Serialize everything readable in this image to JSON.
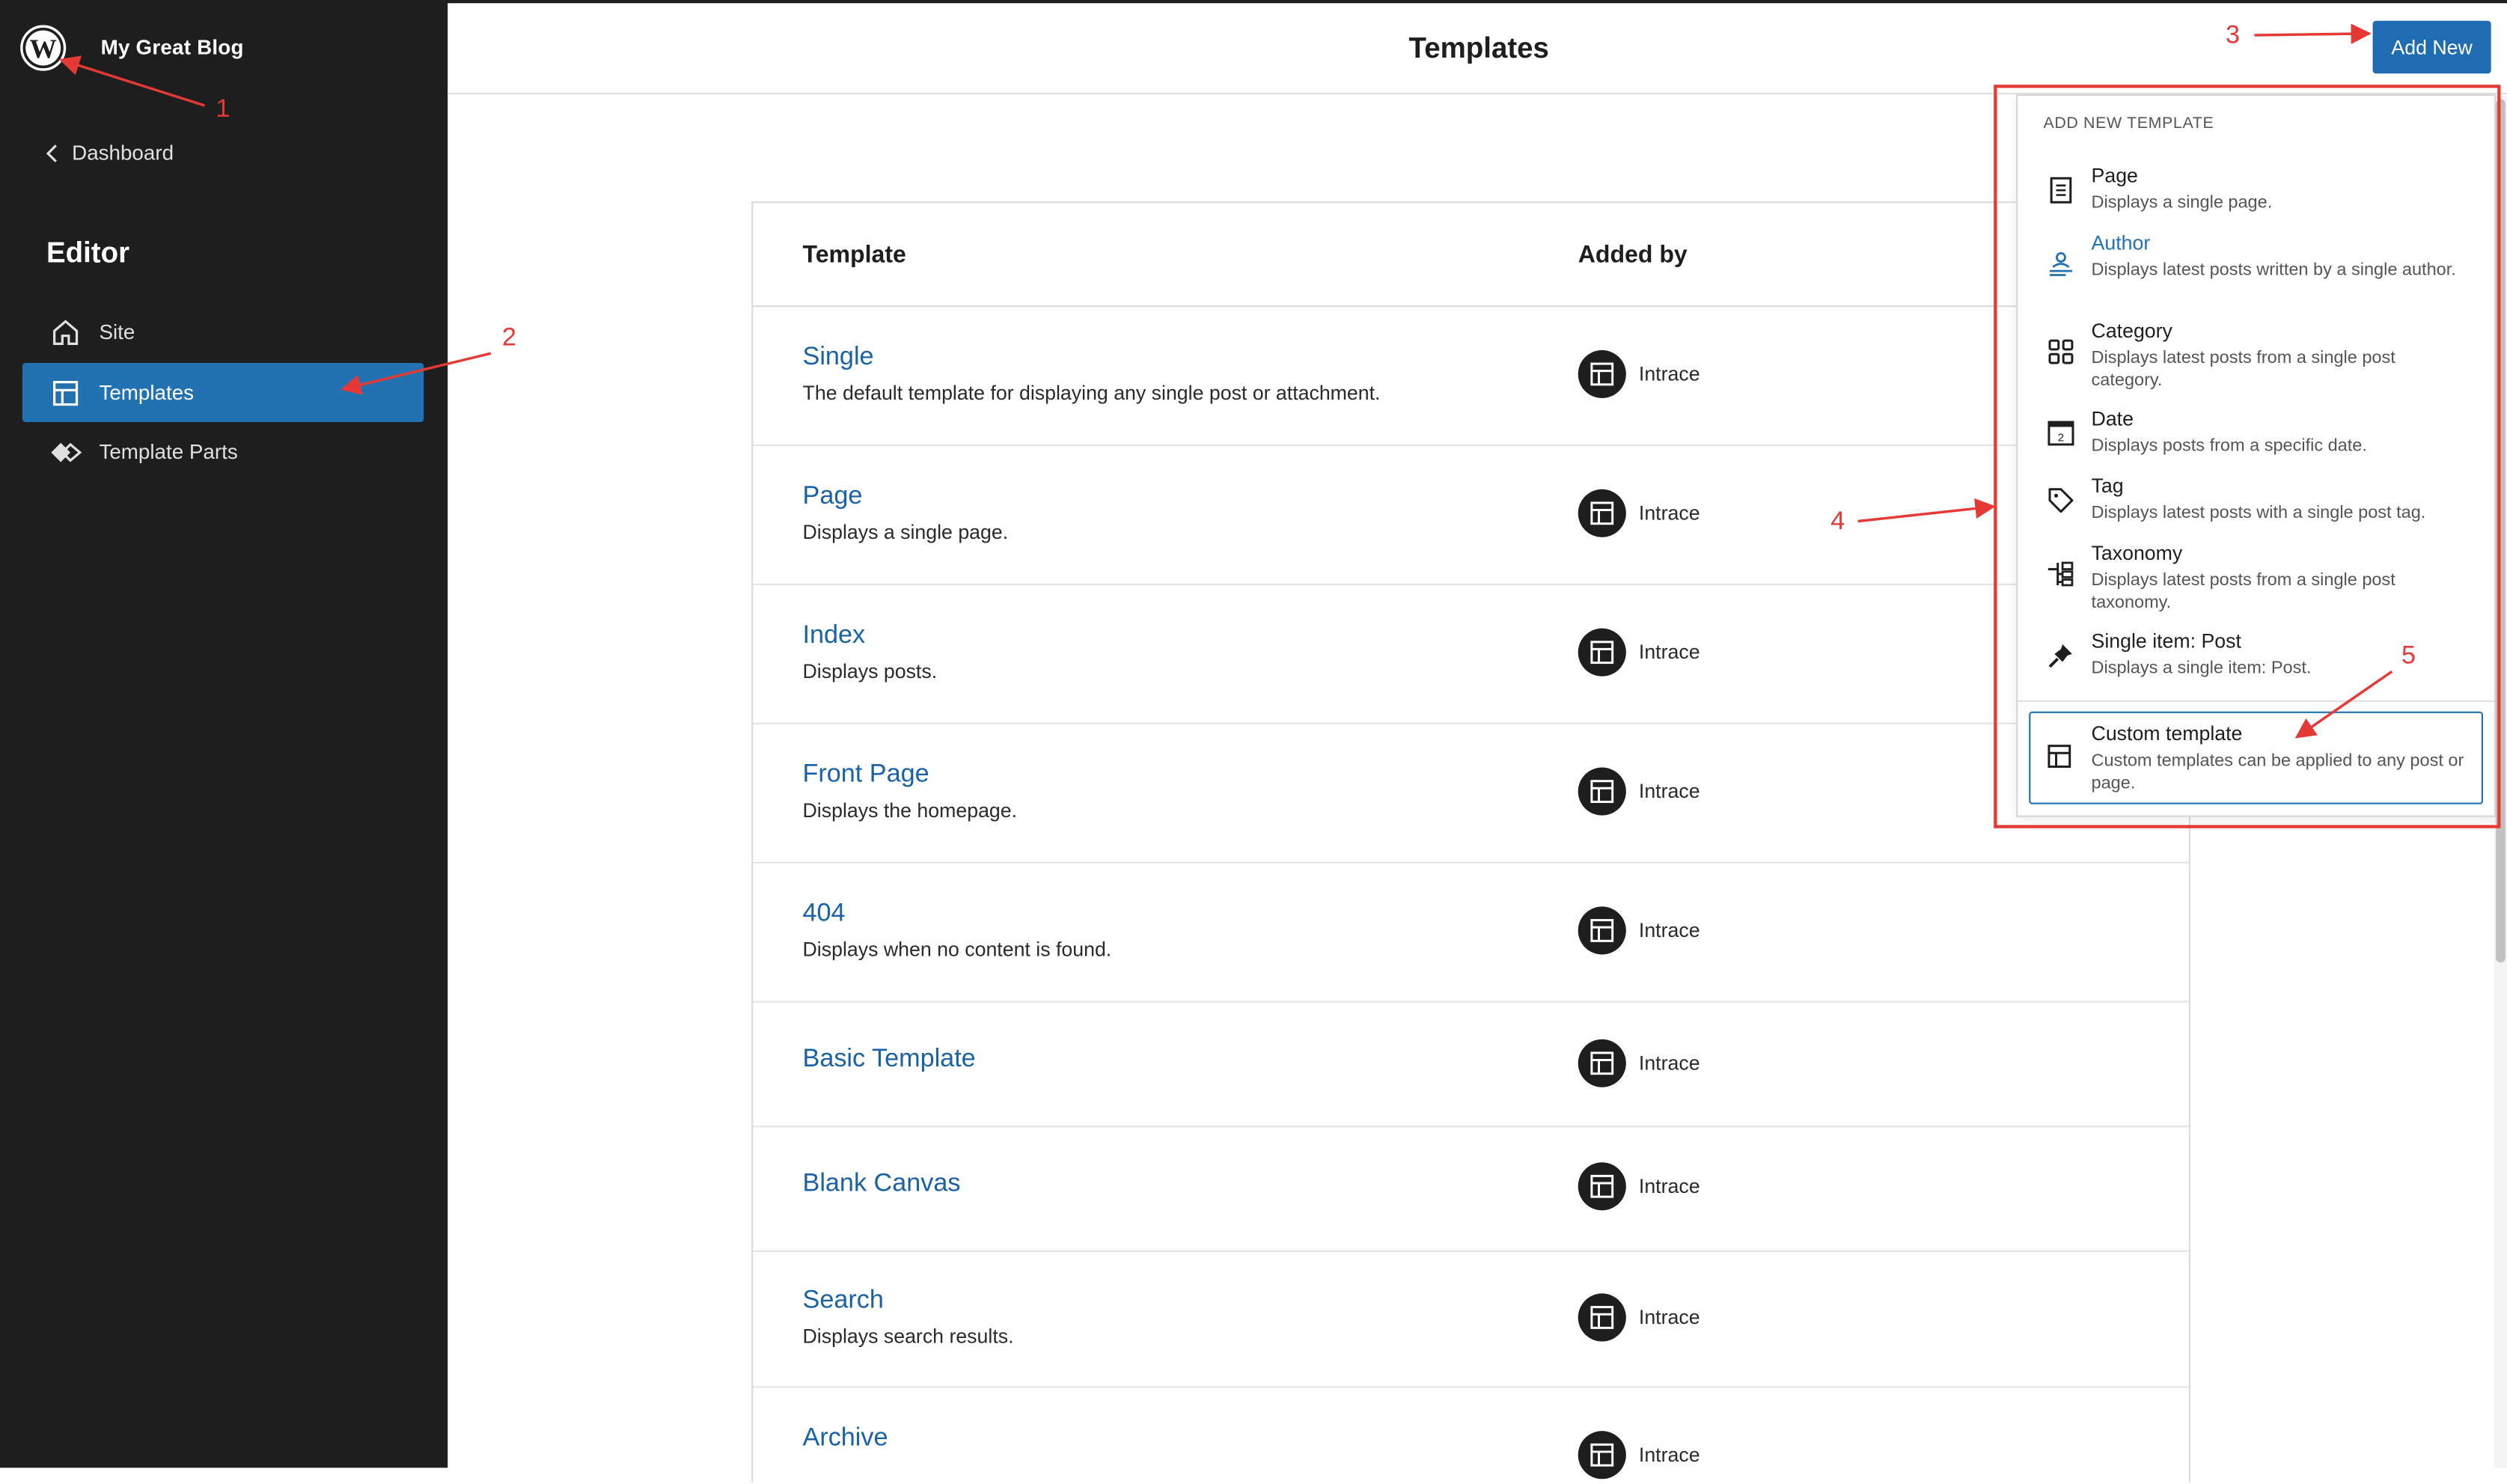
{
  "sidebar": {
    "site_title": "My Great Blog",
    "dashboard_link": "Dashboard",
    "section_heading": "Editor",
    "items": [
      {
        "label": "Site",
        "icon": "home-icon",
        "active": false
      },
      {
        "label": "Templates",
        "icon": "layout-icon",
        "active": true
      },
      {
        "label": "Template Parts",
        "icon": "diamond-icon",
        "active": false
      }
    ]
  },
  "header": {
    "title": "Templates",
    "add_new_label": "Add New"
  },
  "table": {
    "columns": [
      "Template",
      "Added by"
    ],
    "rows": [
      {
        "name": "Single",
        "description": "The default template for displaying any single post or attachment.",
        "added_by": "Intrace"
      },
      {
        "name": "Page",
        "description": "Displays a single page.",
        "added_by": "Intrace"
      },
      {
        "name": "Index",
        "description": "Displays posts.",
        "added_by": "Intrace"
      },
      {
        "name": "Front Page",
        "description": "Displays the homepage.",
        "added_by": "Intrace"
      },
      {
        "name": "404",
        "description": "Displays when no content is found.",
        "added_by": "Intrace"
      },
      {
        "name": "Basic Template",
        "description": "",
        "added_by": "Intrace"
      },
      {
        "name": "Blank Canvas",
        "description": "",
        "added_by": "Intrace"
      },
      {
        "name": "Search",
        "description": "Displays search results.",
        "added_by": "Intrace"
      },
      {
        "name": "Archive",
        "description": "",
        "added_by": "Intrace"
      }
    ]
  },
  "dropdown": {
    "heading": "ADD NEW TEMPLATE",
    "items": [
      {
        "title": "Page",
        "description": "Displays a single page.",
        "icon": "page-icon"
      },
      {
        "title": "Author",
        "description": "Displays latest posts written by a single author.",
        "icon": "author-icon"
      },
      {
        "title": "Category",
        "description": "Displays latest posts from a single post category.",
        "icon": "category-icon"
      },
      {
        "title": "Date",
        "description": "Displays posts from a specific date.",
        "icon": "calendar-icon"
      },
      {
        "title": "Tag",
        "description": "Displays latest posts with a single post tag.",
        "icon": "tag-icon"
      },
      {
        "title": "Taxonomy",
        "description": "Displays latest posts from a single post taxonomy.",
        "icon": "taxonomy-icon"
      },
      {
        "title": "Single item: Post",
        "description": "Displays a single item: Post.",
        "icon": "pin-icon"
      }
    ],
    "custom": {
      "title": "Custom template",
      "description": "Custom templates can be applied to any post or page."
    }
  },
  "annotations": [
    "1",
    "2",
    "3",
    "4",
    "5"
  ],
  "colors": {
    "accent": "#2271b1",
    "annotation": "#e53935",
    "sidebar_bg": "#1e1e1e",
    "link": "#1a62a8"
  }
}
